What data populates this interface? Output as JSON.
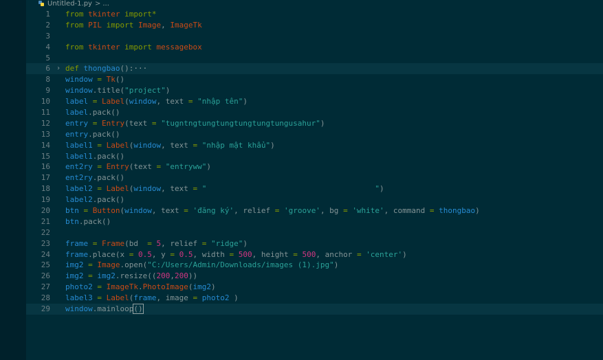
{
  "breadcrumb": {
    "filename": "Untitled-1.py",
    "separator": ">",
    "symbol": "..."
  },
  "editor": {
    "current_line": 29,
    "lines": [
      {
        "n": "1",
        "fold": "",
        "tokens": [
          {
            "t": "from ",
            "c": "kw"
          },
          {
            "t": "tkinter",
            "c": "mod"
          },
          {
            "t": " import",
            "c": "kw"
          },
          {
            "t": "*",
            "c": "op"
          }
        ]
      },
      {
        "n": "2",
        "fold": "",
        "tokens": [
          {
            "t": "from ",
            "c": "kw"
          },
          {
            "t": "PIL",
            "c": "mod"
          },
          {
            "t": " import",
            "c": "kw"
          },
          {
            "t": " Image",
            "c": "cls"
          },
          {
            "t": ", ",
            "c": ""
          },
          {
            "t": "ImageTk",
            "c": "cls"
          }
        ]
      },
      {
        "n": "3",
        "fold": "",
        "tokens": []
      },
      {
        "n": "4",
        "fold": "",
        "tokens": [
          {
            "t": "from ",
            "c": "kw"
          },
          {
            "t": "tkinter",
            "c": "mod"
          },
          {
            "t": " import",
            "c": "kw"
          },
          {
            "t": " messagebox",
            "c": "cls"
          }
        ]
      },
      {
        "n": "5",
        "fold": "",
        "tokens": []
      },
      {
        "n": "6",
        "fold": "›",
        "tokens": [
          {
            "t": "def ",
            "c": "kw"
          },
          {
            "t": "thongbao",
            "c": "fn"
          },
          {
            "t": "():",
            "c": ""
          },
          {
            "t": "···",
            "c": "fold"
          }
        ]
      },
      {
        "n": "8",
        "fold": "",
        "tokens": [
          {
            "t": "window",
            "c": "var"
          },
          {
            "t": " = ",
            "c": "op"
          },
          {
            "t": "Tk",
            "c": "cls"
          },
          {
            "t": "()",
            "c": ""
          }
        ]
      },
      {
        "n": "9",
        "fold": "",
        "tokens": [
          {
            "t": "window",
            "c": "var"
          },
          {
            "t": ".title(",
            "c": ""
          },
          {
            "t": "\"project\"",
            "c": "str"
          },
          {
            "t": ")",
            "c": ""
          }
        ]
      },
      {
        "n": "10",
        "fold": "",
        "tokens": [
          {
            "t": "label",
            "c": "var"
          },
          {
            "t": " = ",
            "c": "op"
          },
          {
            "t": "Label",
            "c": "cls"
          },
          {
            "t": "(",
            "c": ""
          },
          {
            "t": "window",
            "c": "var"
          },
          {
            "t": ", text ",
            "c": ""
          },
          {
            "t": "= ",
            "c": "op"
          },
          {
            "t": "\"nhập tên\"",
            "c": "str"
          },
          {
            "t": ")",
            "c": ""
          }
        ]
      },
      {
        "n": "11",
        "fold": "",
        "tokens": [
          {
            "t": "label",
            "c": "var"
          },
          {
            "t": ".pack()",
            "c": ""
          }
        ]
      },
      {
        "n": "12",
        "fold": "",
        "tokens": [
          {
            "t": "entry",
            "c": "var"
          },
          {
            "t": " = ",
            "c": "op"
          },
          {
            "t": "Entry",
            "c": "cls"
          },
          {
            "t": "(text ",
            "c": ""
          },
          {
            "t": "= ",
            "c": "op"
          },
          {
            "t": "\"tugntngtungtungtungtungtungusahur\"",
            "c": "str"
          },
          {
            "t": ")",
            "c": ""
          }
        ]
      },
      {
        "n": "13",
        "fold": "",
        "tokens": [
          {
            "t": "entry",
            "c": "var"
          },
          {
            "t": ".pack()",
            "c": ""
          }
        ]
      },
      {
        "n": "14",
        "fold": "",
        "tokens": [
          {
            "t": "label1",
            "c": "var"
          },
          {
            "t": " = ",
            "c": "op"
          },
          {
            "t": "Label",
            "c": "cls"
          },
          {
            "t": "(",
            "c": ""
          },
          {
            "t": "window",
            "c": "var"
          },
          {
            "t": ", text ",
            "c": ""
          },
          {
            "t": "= ",
            "c": "op"
          },
          {
            "t": "\"nhập mật khẩu\"",
            "c": "str"
          },
          {
            "t": ")",
            "c": ""
          }
        ]
      },
      {
        "n": "15",
        "fold": "",
        "tokens": [
          {
            "t": "label1",
            "c": "var"
          },
          {
            "t": ".pack()",
            "c": ""
          }
        ]
      },
      {
        "n": "16",
        "fold": "",
        "tokens": [
          {
            "t": "ent2ry",
            "c": "var"
          },
          {
            "t": " = ",
            "c": "op"
          },
          {
            "t": "Entry",
            "c": "cls"
          },
          {
            "t": "(text ",
            "c": ""
          },
          {
            "t": "= ",
            "c": "op"
          },
          {
            "t": "\"entryww\"",
            "c": "str"
          },
          {
            "t": ")",
            "c": ""
          }
        ]
      },
      {
        "n": "17",
        "fold": "",
        "tokens": [
          {
            "t": "ent2ry",
            "c": "var"
          },
          {
            "t": ".pack()",
            "c": ""
          }
        ]
      },
      {
        "n": "18",
        "fold": "",
        "tokens": [
          {
            "t": "label2",
            "c": "var"
          },
          {
            "t": " = ",
            "c": "op"
          },
          {
            "t": "Label",
            "c": "cls"
          },
          {
            "t": "(",
            "c": ""
          },
          {
            "t": "window",
            "c": "var"
          },
          {
            "t": ", text ",
            "c": ""
          },
          {
            "t": "= ",
            "c": "op"
          },
          {
            "t": "\"                                     \"",
            "c": "str"
          },
          {
            "t": ")",
            "c": ""
          }
        ]
      },
      {
        "n": "19",
        "fold": "",
        "tokens": [
          {
            "t": "label2",
            "c": "var"
          },
          {
            "t": ".pack()",
            "c": ""
          }
        ]
      },
      {
        "n": "20",
        "fold": "",
        "tokens": [
          {
            "t": "btn",
            "c": "var"
          },
          {
            "t": " = ",
            "c": "op"
          },
          {
            "t": "Button",
            "c": "cls"
          },
          {
            "t": "(",
            "c": ""
          },
          {
            "t": "window",
            "c": "var"
          },
          {
            "t": ", text ",
            "c": ""
          },
          {
            "t": "= ",
            "c": "op"
          },
          {
            "t": "'đăng ký'",
            "c": "str"
          },
          {
            "t": ", relief ",
            "c": ""
          },
          {
            "t": "= ",
            "c": "op"
          },
          {
            "t": "'groove'",
            "c": "str"
          },
          {
            "t": ", bg ",
            "c": ""
          },
          {
            "t": "= ",
            "c": "op"
          },
          {
            "t": "'white'",
            "c": "str"
          },
          {
            "t": ", command ",
            "c": ""
          },
          {
            "t": "= ",
            "c": "op"
          },
          {
            "t": "thongbao",
            "c": "fn"
          },
          {
            "t": ")",
            "c": ""
          }
        ]
      },
      {
        "n": "21",
        "fold": "",
        "tokens": [
          {
            "t": "btn",
            "c": "var"
          },
          {
            "t": ".pack()",
            "c": ""
          }
        ]
      },
      {
        "n": "22",
        "fold": "",
        "tokens": []
      },
      {
        "n": "23",
        "fold": "",
        "tokens": [
          {
            "t": "frame",
            "c": "var"
          },
          {
            "t": " = ",
            "c": "op"
          },
          {
            "t": "Frame",
            "c": "cls"
          },
          {
            "t": "(bd  ",
            "c": ""
          },
          {
            "t": "= ",
            "c": "op"
          },
          {
            "t": "5",
            "c": "num"
          },
          {
            "t": ", relief ",
            "c": ""
          },
          {
            "t": "= ",
            "c": "op"
          },
          {
            "t": "\"ridge\"",
            "c": "str"
          },
          {
            "t": ")",
            "c": ""
          }
        ]
      },
      {
        "n": "24",
        "fold": "",
        "tokens": [
          {
            "t": "frame",
            "c": "var"
          },
          {
            "t": ".place(x ",
            "c": ""
          },
          {
            "t": "= ",
            "c": "op"
          },
          {
            "t": "0.5",
            "c": "num"
          },
          {
            "t": ", y ",
            "c": ""
          },
          {
            "t": "= ",
            "c": "op"
          },
          {
            "t": "0.5",
            "c": "num"
          },
          {
            "t": ", width ",
            "c": ""
          },
          {
            "t": "= ",
            "c": "op"
          },
          {
            "t": "500",
            "c": "num"
          },
          {
            "t": ", height ",
            "c": ""
          },
          {
            "t": "= ",
            "c": "op"
          },
          {
            "t": "500",
            "c": "num"
          },
          {
            "t": ", anchor ",
            "c": ""
          },
          {
            "t": "= ",
            "c": "op"
          },
          {
            "t": "'center'",
            "c": "str"
          },
          {
            "t": ")",
            "c": ""
          }
        ]
      },
      {
        "n": "25",
        "fold": "",
        "tokens": [
          {
            "t": "img2",
            "c": "var"
          },
          {
            "t": " = ",
            "c": "op"
          },
          {
            "t": "Image",
            "c": "cls"
          },
          {
            "t": ".open(",
            "c": ""
          },
          {
            "t": "\"C:/Users/Admin/Downloads/images (1).jpg\"",
            "c": "str"
          },
          {
            "t": ")",
            "c": ""
          }
        ]
      },
      {
        "n": "26",
        "fold": "",
        "tokens": [
          {
            "t": "img2",
            "c": "var"
          },
          {
            "t": " = ",
            "c": "op"
          },
          {
            "t": "img2",
            "c": "var"
          },
          {
            "t": ".resize((",
            "c": ""
          },
          {
            "t": "200",
            "c": "num"
          },
          {
            "t": ",",
            "c": ""
          },
          {
            "t": "200",
            "c": "num"
          },
          {
            "t": "))",
            "c": ""
          }
        ]
      },
      {
        "n": "27",
        "fold": "",
        "tokens": [
          {
            "t": "photo2",
            "c": "var"
          },
          {
            "t": " = ",
            "c": "op"
          },
          {
            "t": "ImageTk",
            "c": "cls"
          },
          {
            "t": ".",
            "c": ""
          },
          {
            "t": "PhotoImage",
            "c": "cls"
          },
          {
            "t": "(",
            "c": ""
          },
          {
            "t": "img2",
            "c": "var"
          },
          {
            "t": ")",
            "c": ""
          }
        ]
      },
      {
        "n": "28",
        "fold": "",
        "tokens": [
          {
            "t": "label3",
            "c": "var"
          },
          {
            "t": " = ",
            "c": "op"
          },
          {
            "t": "Label",
            "c": "cls"
          },
          {
            "t": "(",
            "c": ""
          },
          {
            "t": "frame",
            "c": "var"
          },
          {
            "t": ", image ",
            "c": ""
          },
          {
            "t": "= ",
            "c": "op"
          },
          {
            "t": "photo2",
            "c": "var"
          },
          {
            "t": " )",
            "c": ""
          }
        ]
      },
      {
        "n": "29",
        "fold": "",
        "tokens": [
          {
            "t": "window",
            "c": "var"
          },
          {
            "t": ".mainloop",
            "c": ""
          },
          {
            "t": "()",
            "c": "cursor"
          }
        ]
      }
    ]
  },
  "theme": {
    "background": "#002b36",
    "current_line_background": "#073642",
    "keyword": "#859900",
    "string": "#2aa198",
    "number": "#d33682",
    "class": "#cb4b16",
    "variable": "#268bd2"
  }
}
